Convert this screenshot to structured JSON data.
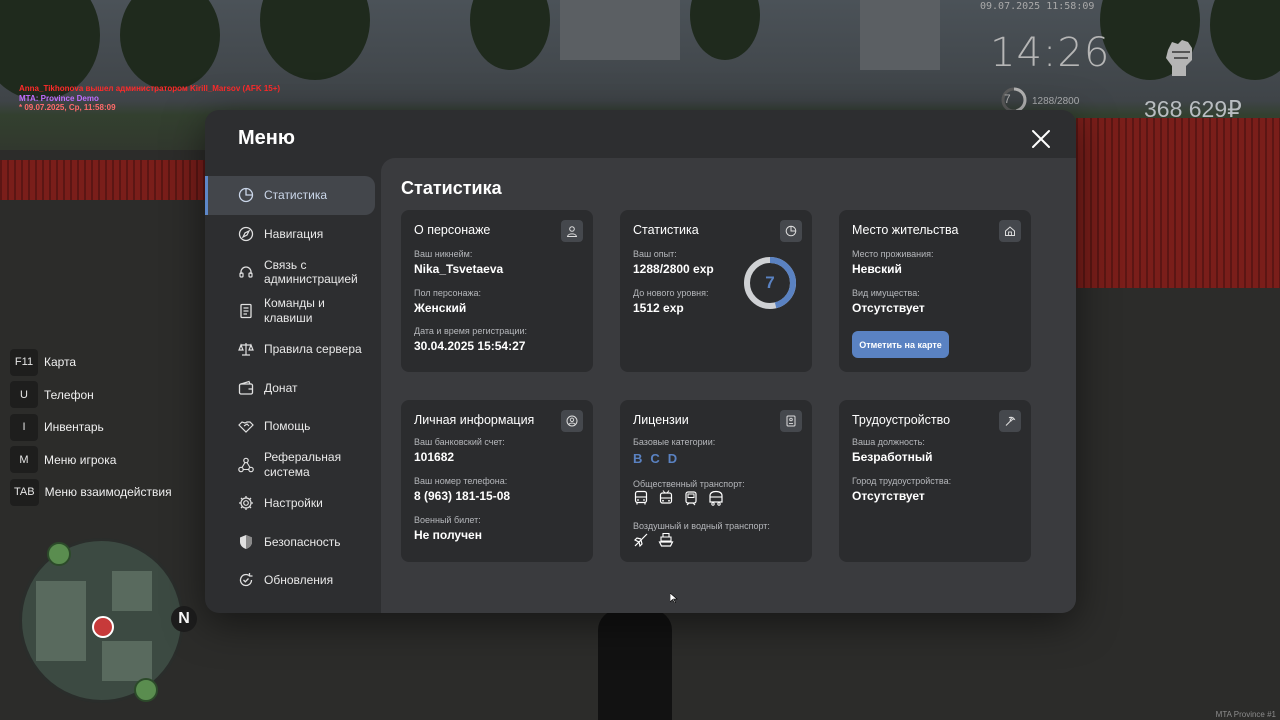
{
  "chat": {
    "line1": "Anna_Tikhonova вышел администратором Kirill_Marsov (AFK 15+)",
    "line2": "MTA: Province Demo",
    "line3": "* 09.07.2025, Ср, 11:58:09"
  },
  "hud": {
    "datetime": "09.07.2025 11:58:09",
    "time": "14:26",
    "level": "7",
    "exp": "1288/2800",
    "exp_fraction": 0.46,
    "money": "368 629₽",
    "fist_icon": "fist-icon"
  },
  "binds": [
    {
      "key": "F11",
      "label": "Карта"
    },
    {
      "key": "U",
      "label": "Телефон"
    },
    {
      "key": "I",
      "label": "Инвентарь"
    },
    {
      "key": "M",
      "label": "Меню игрока"
    },
    {
      "key": "TAB",
      "label": "Меню взаимодействия"
    }
  ],
  "minimap": {
    "north": "N"
  },
  "menu": {
    "title": "Меню",
    "nav": [
      {
        "label": "Статистика",
        "icon": "pie-chart-icon",
        "active": true
      },
      {
        "label": "Навигация",
        "icon": "compass-icon"
      },
      {
        "label": "Связь с администрацией",
        "icon": "headset-icon"
      },
      {
        "label": "Команды и клавиши",
        "icon": "document-icon"
      },
      {
        "label": "Правила сервера",
        "icon": "scales-icon"
      },
      {
        "label": "Донат",
        "icon": "wallet-icon"
      },
      {
        "label": "Помощь",
        "icon": "handshake-icon"
      },
      {
        "label": "Реферальная система",
        "icon": "network-icon"
      },
      {
        "label": "Настройки",
        "icon": "gear-icon"
      },
      {
        "label": "Безопасность",
        "icon": "shield-icon"
      },
      {
        "label": "Обновления",
        "icon": "update-icon"
      }
    ],
    "content_title": "Статистика",
    "character": {
      "title": "О персонаже",
      "nickname_label": "Ваш никнейм:",
      "nickname": "Nika_Tsvetaeva",
      "gender_label": "Пол персонажа:",
      "gender": "Женский",
      "reg_label": "Дата и время регистрации:",
      "reg": "30.04.2025 15:54:27"
    },
    "stats": {
      "title": "Статистика",
      "exp_label": "Ваш опыт:",
      "exp": "1288/2800 exp",
      "next_label": "До нового уровня:",
      "next": "1512 exp",
      "level": "7",
      "progress": 0.46,
      "accent": "#5a82c2"
    },
    "residence": {
      "title": "Место жительства",
      "place_label": "Место проживания:",
      "place": "Невский",
      "property_label": "Вид имущества:",
      "property": "Отсутствует",
      "button": "Отметить на карте"
    },
    "personal": {
      "title": "Личная информация",
      "bank_label": "Ваш банковский счет:",
      "bank": "101682",
      "phone_label": "Ваш номер телефона:",
      "phone": "8 (963) 181-15-08",
      "military_label": "Военный билет:",
      "military": "Не получен"
    },
    "licenses": {
      "title": "Лицензии",
      "base_label": "Базовые категории:",
      "categories": [
        "B",
        "C",
        "D"
      ],
      "public_label": "Общественный транспорт:",
      "public_icons": [
        "bus-icon",
        "trolleybus-icon",
        "tram-icon",
        "minibus-icon"
      ],
      "air_label": "Воздушный и водный транспорт:",
      "air_icons": [
        "plane-icon",
        "boat-icon"
      ]
    },
    "employment": {
      "title": "Трудоустройство",
      "position_label": "Ваша должность:",
      "position": "Безработный",
      "city_label": "Город трудоустройства:",
      "city": "Отсутствует"
    }
  },
  "watermark": "MTA Province #1"
}
